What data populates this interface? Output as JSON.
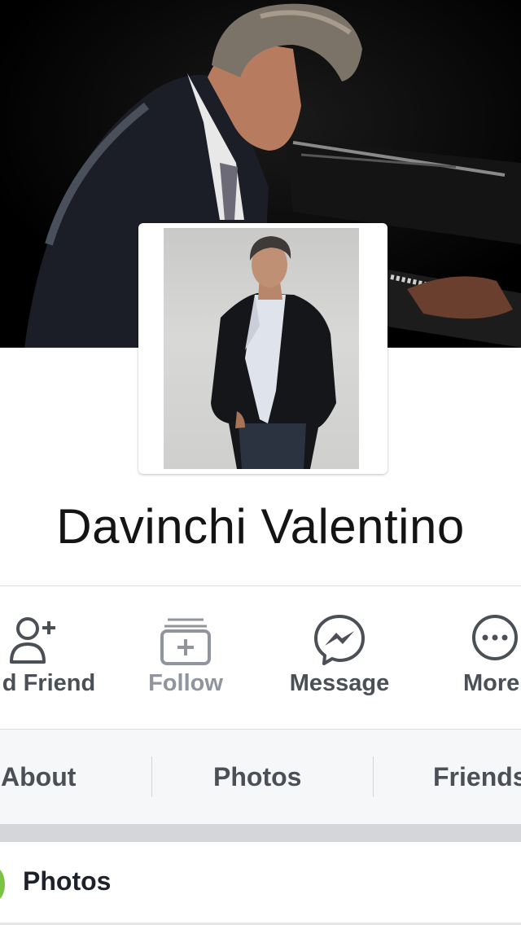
{
  "profile": {
    "name": "Davinchi Valentino"
  },
  "actions": [
    {
      "label": "d Friend",
      "icon": "add-friend-icon",
      "enabled": true
    },
    {
      "label": "Follow",
      "icon": "follow-icon",
      "enabled": false
    },
    {
      "label": "Message",
      "icon": "messenger-icon",
      "enabled": true
    },
    {
      "label": "More",
      "icon": "more-icon",
      "enabled": true
    }
  ],
  "tabs": [
    {
      "label": "About"
    },
    {
      "label": "Photos"
    },
    {
      "label": "Friends"
    }
  ],
  "photos_section": {
    "title": "Photos"
  },
  "colors": {
    "action_text": "#4b4f56",
    "action_text_disabled": "#90949c",
    "tabs_background": "#f6f7f9",
    "photos_accent": "#7bc443"
  }
}
